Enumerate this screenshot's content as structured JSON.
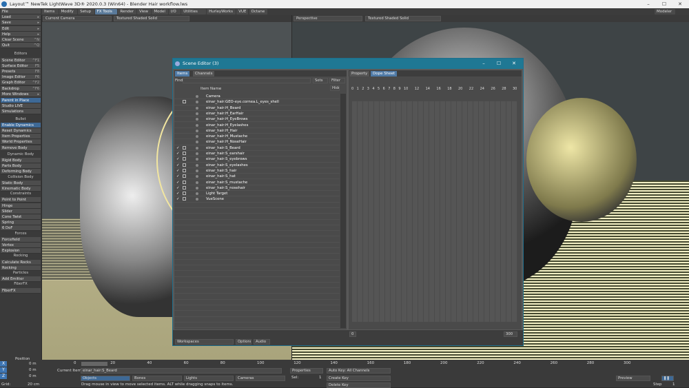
{
  "window": {
    "title": "Layout™ NewTek LightWave 3D® 2020.0.3 (Win64) - Blender Hair workflow.lws",
    "minimize": "–",
    "maximize": "☐",
    "close": "✕"
  },
  "menu": {
    "tabs": [
      "Items",
      "Modify",
      "Setup",
      "FX Tools",
      "Render",
      "View",
      "Model",
      "I/O",
      "Utilities",
      "HurleyWorks",
      "VUE",
      "Octane"
    ],
    "active": "FX Tools",
    "modeler": "Modeler"
  },
  "sidebar": {
    "top": [
      {
        "label": "File"
      },
      {
        "label": "Load",
        "sc": "▸"
      },
      {
        "label": "Save",
        "sc": "▸"
      },
      {
        "label": "Edit",
        "sc": "▸"
      },
      {
        "label": "Help",
        "sc": "▸"
      },
      {
        "label": "Clear Scene",
        "sc": "^N"
      },
      {
        "label": "Quit",
        "sc": "^Q"
      }
    ],
    "editors_head": "Editors",
    "editors": [
      {
        "label": "Scene Editor",
        "sc": "^F1"
      },
      {
        "label": "Surface Editor",
        "sc": "F5"
      },
      {
        "label": "Presets",
        "sc": "F8"
      },
      {
        "label": "Image Editor",
        "sc": "F6"
      },
      {
        "label": "Graph Editor",
        "sc": "^F2"
      },
      {
        "label": "Backdrop",
        "sc": "^F6"
      },
      {
        "label": "More Windows",
        "sc": "▸"
      }
    ],
    "misc": [
      {
        "label": "Parent in Place",
        "blue": true
      },
      {
        "label": "Studio LIVE"
      },
      {
        "label": "Simulations"
      }
    ],
    "bullet_head": "Bullet",
    "bullet": [
      {
        "label": "Enable Dynamics",
        "blue": true
      },
      {
        "label": "Reset Dynamics"
      },
      {
        "label": "Item Properties"
      },
      {
        "label": "World Properties"
      },
      {
        "label": "Remove Body"
      }
    ],
    "dyn_head": "Dynamic Body",
    "dyn": [
      "Rigid Body",
      "Parts Body",
      "Deforming Body"
    ],
    "col_head": "Collision Body",
    "col": [
      "Static Body",
      "Kinematic Body"
    ],
    "con_head": "Constraints",
    "con": [
      "Point to Point",
      "Hinge",
      "Slider",
      "Cone Twist",
      "Spring",
      "6 DoF"
    ],
    "for_head": "Forces",
    "for": [
      "Forcefield",
      "Vortex",
      "Explosion"
    ],
    "rock_head": "Rocking",
    "rock": [
      "Calculate Rocks",
      "Rocking"
    ],
    "part_head": "Particles",
    "part": [
      "Add Emitter"
    ],
    "fiber_head": "FiberFX",
    "fiber": [
      "FiberFX"
    ]
  },
  "viewport_left": {
    "camera": "Current Camera",
    "shading": "Textured Shaded Solid"
  },
  "viewport_right": {
    "view": "Perspective",
    "shading": "Textured Shaded Solid"
  },
  "scene_editor": {
    "title": "Scene Editor (3)",
    "tabs": [
      "Items",
      "Channels"
    ],
    "find_label": "Find",
    "sets": "Sets",
    "filter": "Filter",
    "hide": "Hide",
    "col_item": "Item",
    "col_name": "Name",
    "rows": [
      {
        "name": "Camera",
        "ck": "",
        "bx": false,
        "ind": 49
      },
      {
        "name": "einar_hair:GEO-eye.cornea.L_eyes_shell",
        "ck": "",
        "bx": true,
        "ind": 49
      },
      {
        "name": "einar_hair:H_Beard",
        "ck": "",
        "bx": false,
        "ind": 49
      },
      {
        "name": "einar_hair:H_EarHair",
        "ck": "",
        "bx": false,
        "ind": 49
      },
      {
        "name": "einar_hair:H_EyeBrows",
        "ck": "",
        "bx": false,
        "ind": 49
      },
      {
        "name": "einar_hair:H_Eyelashes",
        "ck": "",
        "bx": false,
        "ind": 49
      },
      {
        "name": "einar_hair:H_Hair",
        "ck": "",
        "bx": false,
        "ind": 49
      },
      {
        "name": "einar_hair:H_Mustache",
        "ck": "",
        "bx": false,
        "ind": 49
      },
      {
        "name": "einar_hair:H_NoseHair",
        "ck": "",
        "bx": false,
        "ind": 49
      },
      {
        "name": "einar_hair:S_Beard",
        "ck": "✓",
        "bx": true,
        "ind": 49
      },
      {
        "name": "einar_hair:S_earshair",
        "ck": "✓",
        "bx": true,
        "ind": 49
      },
      {
        "name": "einar_hair:S_eyebrows",
        "ck": "✓",
        "bx": true,
        "ind": 49
      },
      {
        "name": "einar_hair:S_eyelashes",
        "ck": "✓",
        "bx": true,
        "ind": 49
      },
      {
        "name": "einar_hair:S_hair",
        "ck": "✓",
        "bx": true,
        "ind": 49
      },
      {
        "name": "einar_hair:S_hat",
        "ck": "✓",
        "bx": true,
        "ind": 49
      },
      {
        "name": "einar_hair:S_mustache",
        "ck": "✓",
        "bx": true,
        "ind": 49
      },
      {
        "name": "einar_hair:S_nosehair",
        "ck": "✓",
        "bx": true,
        "ind": 49
      },
      {
        "name": "Light Target",
        "ck": "✓",
        "bx": true,
        "ind": 49
      },
      {
        "name": "VueScene",
        "ck": "✓",
        "bx": true,
        "ind": 49
      }
    ],
    "right_tabs": [
      "Property",
      "Dope Sheet"
    ],
    "frames": [
      "0",
      "1",
      "2",
      "3",
      "4",
      "5",
      "6",
      "7",
      "8",
      "9",
      "10",
      "12",
      "14",
      "16",
      "18",
      "20",
      "22",
      "24",
      "26",
      "28",
      "30"
    ],
    "end_frame": "300",
    "start_frame": "0",
    "workspaces": "Workspaces",
    "options": "Options",
    "audio": "Audio"
  },
  "bottom": {
    "position": "Position",
    "axes": [
      {
        "axis": "X",
        "value": "0 m"
      },
      {
        "axis": "Y",
        "value": "0 m"
      },
      {
        "axis": "Z",
        "value": "0 m"
      }
    ],
    "grid_label": "Grid:",
    "grid_value": "20 cm",
    "current_item_label": "Current Item",
    "current_item": "einar_hair:S_Beard",
    "objects": "Objects",
    "bones": "Bones",
    "lights": "Lights",
    "cameras": "Cameras",
    "properties": "Properties",
    "sel_label": "Sel:",
    "sel_value": "1",
    "autokey": "Auto Key: All Channels",
    "create_key": "Create Key",
    "delete_key": "Delete Key",
    "hint": "Drag mouse in view to move selected items. ALT while dragging snaps to items.",
    "timeline": [
      "0",
      "20",
      "40",
      "60",
      "80",
      "100",
      "120",
      "140",
      "160",
      "180",
      "200",
      "220",
      "240",
      "260",
      "280",
      "300"
    ],
    "preview": "Preview",
    "step_label": "Step",
    "step_value": "1",
    "end": "300"
  }
}
